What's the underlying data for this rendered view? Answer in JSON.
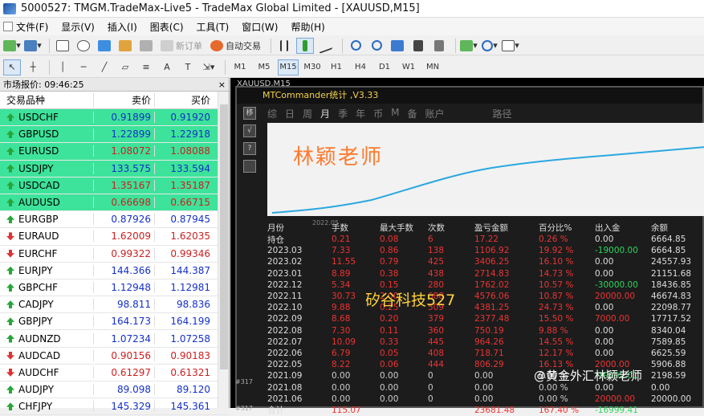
{
  "window": {
    "title": "5000527: TMGM.TradeMax-Live5 - TradeMax Global Limited - [XAUUSD,M15]"
  },
  "menu": [
    "文件(F)",
    "显示(V)",
    "插入(I)",
    "图表(C)",
    "工具(T)",
    "窗口(W)",
    "帮助(H)"
  ],
  "toolbar": {
    "new_order": "新订单",
    "auto_trading": "自动交易"
  },
  "timeframes": [
    "M1",
    "M5",
    "M15",
    "M30",
    "H1",
    "H4",
    "D1",
    "W1",
    "MN"
  ],
  "active_timeframe": "M15",
  "market_watch": {
    "header": "市场报价: 09:46:25",
    "col_symbol": "交易品种",
    "col_bid": "卖价",
    "col_ask": "买价",
    "rows": [
      {
        "symbol": "USDCHF",
        "bid": "0.91899",
        "ask": "0.91920",
        "dir": "up",
        "hl": true,
        "color": "blue"
      },
      {
        "symbol": "GBPUSD",
        "bid": "1.22899",
        "ask": "1.22918",
        "dir": "up",
        "hl": true,
        "color": "blue"
      },
      {
        "symbol": "EURUSD",
        "bid": "1.08072",
        "ask": "1.08088",
        "dir": "up",
        "hl": true,
        "color": "red"
      },
      {
        "symbol": "USDJPY",
        "bid": "133.575",
        "ask": "133.594",
        "dir": "up",
        "hl": true,
        "color": "blue"
      },
      {
        "symbol": "USDCAD",
        "bid": "1.35167",
        "ask": "1.35187",
        "dir": "up",
        "hl": true,
        "color": "red"
      },
      {
        "symbol": "AUDUSD",
        "bid": "0.66698",
        "ask": "0.66715",
        "dir": "up",
        "hl": true,
        "color": "red"
      },
      {
        "symbol": "EURGBP",
        "bid": "0.87926",
        "ask": "0.87945",
        "dir": "up",
        "hl": false,
        "color": "blue"
      },
      {
        "symbol": "EURAUD",
        "bid": "1.62009",
        "ask": "1.62035",
        "dir": "down",
        "hl": false,
        "color": "red"
      },
      {
        "symbol": "EURCHF",
        "bid": "0.99322",
        "ask": "0.99346",
        "dir": "down",
        "hl": false,
        "color": "red"
      },
      {
        "symbol": "EURJPY",
        "bid": "144.366",
        "ask": "144.387",
        "dir": "up",
        "hl": false,
        "color": "blue"
      },
      {
        "symbol": "GBPCHF",
        "bid": "1.12948",
        "ask": "1.12981",
        "dir": "up",
        "hl": false,
        "color": "blue"
      },
      {
        "symbol": "CADJPY",
        "bid": "98.811",
        "ask": "98.836",
        "dir": "up",
        "hl": false,
        "color": "blue"
      },
      {
        "symbol": "GBPJPY",
        "bid": "164.173",
        "ask": "164.199",
        "dir": "up",
        "hl": false,
        "color": "blue"
      },
      {
        "symbol": "AUDNZD",
        "bid": "1.07234",
        "ask": "1.07258",
        "dir": "up",
        "hl": false,
        "color": "blue"
      },
      {
        "symbol": "AUDCAD",
        "bid": "0.90156",
        "ask": "0.90183",
        "dir": "down",
        "hl": false,
        "color": "red"
      },
      {
        "symbol": "AUDCHF",
        "bid": "0.61297",
        "ask": "0.61321",
        "dir": "down",
        "hl": false,
        "color": "red"
      },
      {
        "symbol": "AUDJPY",
        "bid": "89.098",
        "ask": "89.120",
        "dir": "up",
        "hl": false,
        "color": "blue"
      },
      {
        "symbol": "CHFJPY",
        "bid": "145.329",
        "ask": "145.361",
        "dir": "up",
        "hl": false,
        "color": "blue"
      }
    ]
  },
  "chart": {
    "tab": "XAUUSD,M15",
    "panel_title": "MTCommander统计 ,V3.33",
    "periods": [
      "综",
      "日",
      "周",
      "月",
      "季",
      "年",
      "币",
      "M",
      "备",
      "账户"
    ],
    "active_period": "月",
    "path_label": "路径",
    "equity_label": "2022.05",
    "watermark": "林颖老师",
    "watermark2": "矽谷科技527",
    "watermark3": "@黄金外汇林颖老师",
    "side_labels": [
      "移",
      "√",
      "?"
    ],
    "markers": [
      "#317",
      "#317"
    ],
    "columns": [
      "月份",
      "手数",
      "最大手数",
      "次数",
      "盈亏金额",
      "百分比%",
      "出入金",
      "余额"
    ],
    "rows": [
      [
        "持仓",
        "0.21",
        "0.08",
        "6",
        "17.22",
        "0.26 %",
        "0.00",
        "6664.85"
      ],
      [
        "2023.03",
        "7.33",
        "0.86",
        "138",
        "1106.92",
        "19.92 %",
        "-19000.00",
        "6664.85"
      ],
      [
        "2023.02",
        "11.55",
        "0.79",
        "425",
        "3406.25",
        "16.10 %",
        "0.00",
        "24557.93"
      ],
      [
        "2023.01",
        "8.89",
        "0.38",
        "438",
        "2714.83",
        "14.73 %",
        "0.00",
        "21151.68"
      ],
      [
        "2022.12",
        "5.34",
        "0.15",
        "280",
        "1762.02",
        "10.57 %",
        "-30000.00",
        "18436.85"
      ],
      [
        "2022.11",
        "30.73",
        "2.00",
        "688",
        "4576.06",
        "10.87 %",
        "20000.00",
        "46674.83"
      ],
      [
        "2022.10",
        "9.88",
        "0.25",
        "509",
        "4381.25",
        "24.73 %",
        "0.00",
        "22098.77"
      ],
      [
        "2022.09",
        "8.68",
        "0.20",
        "379",
        "2377.48",
        "15.50 %",
        "7000.00",
        "17717.52"
      ],
      [
        "2022.08",
        "7.30",
        "0.11",
        "360",
        "750.19",
        "9.88 %",
        "0.00",
        "8340.04"
      ],
      [
        "2022.07",
        "10.09",
        "0.33",
        "445",
        "964.26",
        "14.55 %",
        "0.00",
        "7589.85"
      ],
      [
        "2022.06",
        "6.79",
        "0.05",
        "408",
        "718.71",
        "12.17 %",
        "0.00",
        "6625.59"
      ],
      [
        "2022.05",
        "8.22",
        "0.06",
        "444",
        "806.29",
        "16.13 %",
        "2000.00",
        "5906.88"
      ],
      [
        "2021.09",
        "0.00",
        "0.00",
        "0",
        "0.00",
        "0.00 %",
        "-19995.01",
        "2198.59"
      ],
      [
        "2021.08",
        "0.00",
        "0.00",
        "0",
        "0.00",
        "0.00 %",
        "0.00",
        "0.00"
      ],
      [
        "2021.06",
        "0.00",
        "0.00",
        "0",
        "0.00",
        "0.00 %",
        "20000.00",
        "20000.00"
      ],
      [
        "合计",
        "115.07",
        "",
        "",
        "23681.48",
        "167.40 %",
        "-16999.41",
        ""
      ]
    ]
  }
}
